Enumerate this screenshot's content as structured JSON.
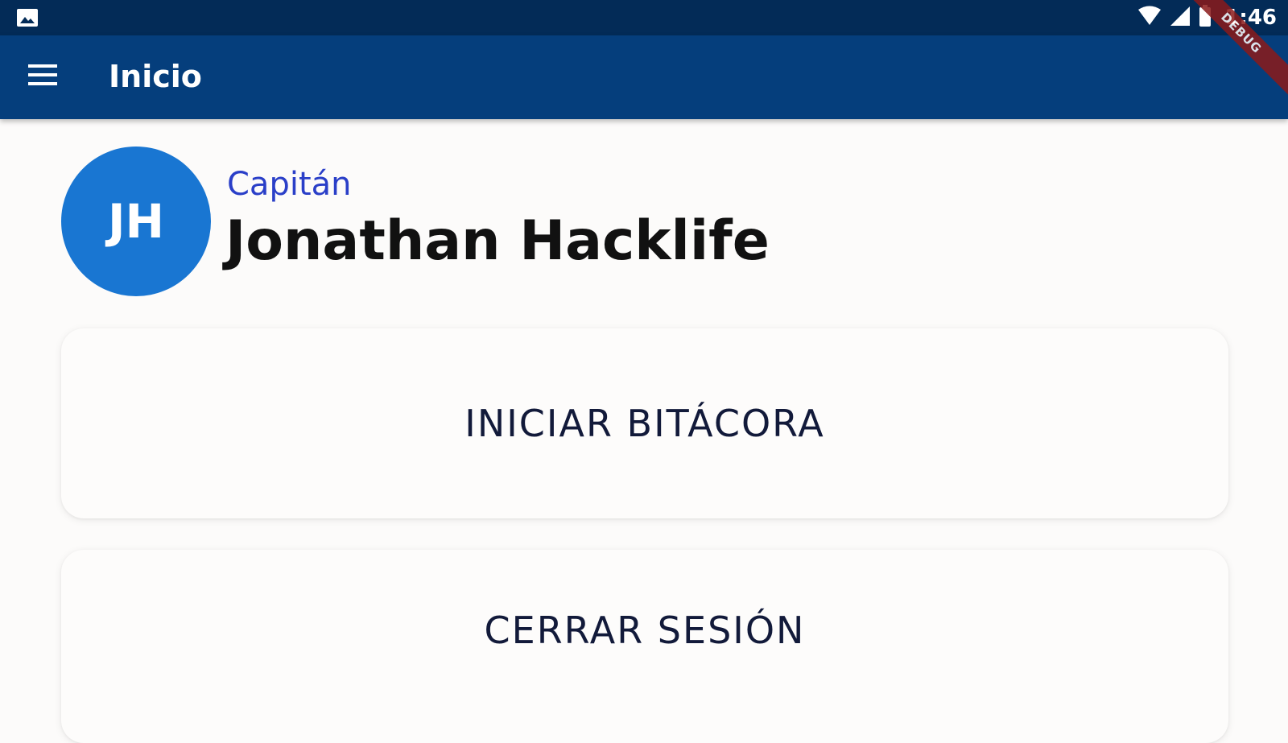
{
  "status_bar": {
    "time": "1:46",
    "icons": [
      "image-icon",
      "wifi-icon",
      "signal-icon",
      "battery-icon"
    ]
  },
  "app_bar": {
    "title": "Inicio",
    "menu_icon": "menu-icon",
    "background": "#053e7c"
  },
  "debug_banner": "DEBUG",
  "profile": {
    "initials": "JH",
    "role": "Capitán",
    "name": "Jonathan Hacklife",
    "avatar_color": "#1976d2",
    "role_color": "#2a3fc8"
  },
  "actions": {
    "start_log_label": "INICIAR BITÁCORA",
    "logout_label": "CERRAR SESIÓN"
  }
}
